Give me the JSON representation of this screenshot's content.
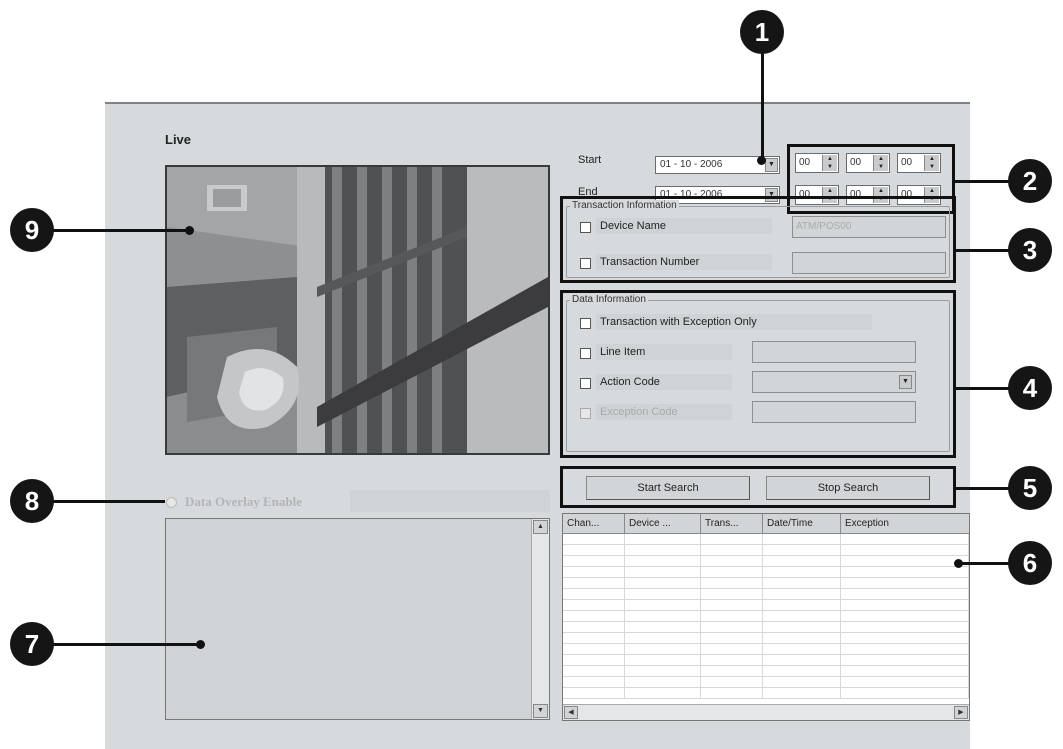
{
  "live_label": "Live",
  "date_range": {
    "start_label": "Start",
    "end_label": "End",
    "start_date": "01 - 10 - 2006",
    "end_date": "01 - 10 - 2006",
    "start_time": [
      "00",
      "00",
      "00"
    ],
    "end_time": [
      "00",
      "00",
      "00"
    ]
  },
  "transaction_info": {
    "title": "Transaction Information",
    "device_name_label": "Device Name",
    "device_name_value": "ATM/POS00",
    "transaction_number_label": "Transaction Number",
    "transaction_number_value": ""
  },
  "data_info": {
    "title": "Data Information",
    "exception_only_label": "Transaction with Exception Only",
    "line_item_label": "Line Item",
    "action_code_label": "Action Code",
    "exception_code_label": "Exception Code"
  },
  "buttons": {
    "start_search": "Start Search",
    "stop_search": "Stop Search"
  },
  "overlay": {
    "label": "Data Overlay Enable"
  },
  "results_table": {
    "columns": [
      "Chan...",
      "Device ...",
      "Trans...",
      "Date/Time",
      "Exception"
    ]
  },
  "callouts": [
    "1",
    "2",
    "3",
    "4",
    "5",
    "6",
    "7",
    "8",
    "9"
  ]
}
